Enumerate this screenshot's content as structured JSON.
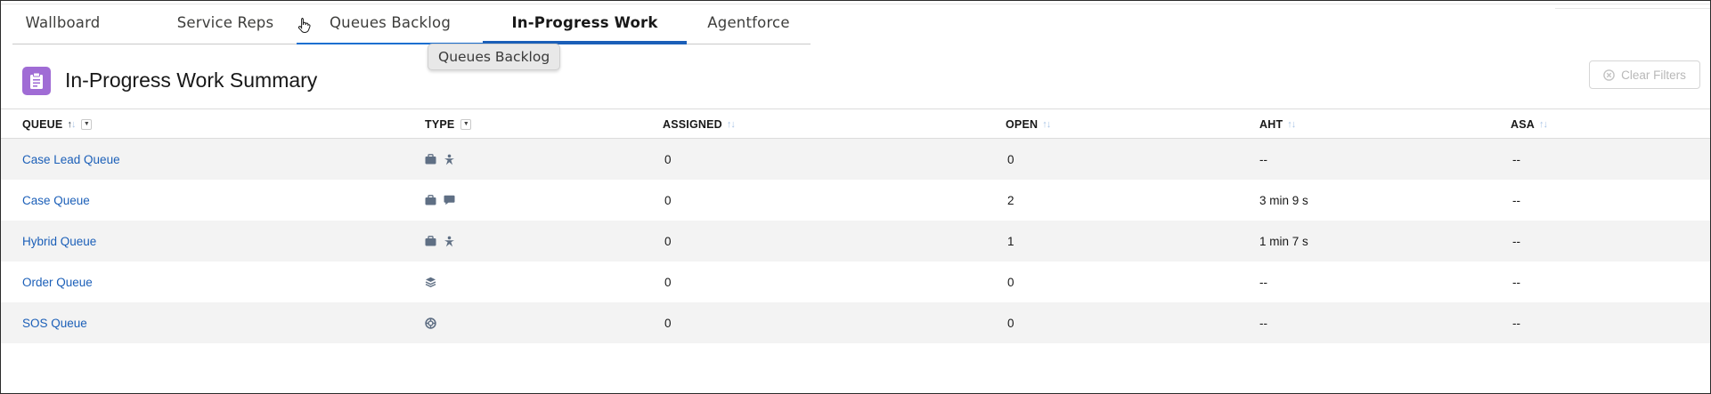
{
  "tabs": [
    {
      "label": "Wallboard",
      "state": "default"
    },
    {
      "label": "Service Reps",
      "state": "default"
    },
    {
      "label": "Queues Backlog",
      "state": "hovered"
    },
    {
      "label": "In-Progress Work",
      "state": "active"
    },
    {
      "label": "Agentforce",
      "state": "default"
    }
  ],
  "tooltip": "Queues Backlog",
  "header": {
    "title": "In-Progress Work Summary",
    "icon": "clipboard-icon",
    "clear_filters_label": "Clear Filters"
  },
  "table": {
    "columns": [
      {
        "label": "QUEUE",
        "sort": "ascending",
        "filter": true
      },
      {
        "label": "TYPE",
        "sort": "none",
        "filter": true
      },
      {
        "label": "ASSIGNED",
        "sort": "sortable"
      },
      {
        "label": "OPEN",
        "sort": "sortable"
      },
      {
        "label": "AHT",
        "sort": "sortable"
      },
      {
        "label": "ASA",
        "sort": "sortable"
      }
    ],
    "rows": [
      {
        "queue": "Case Lead Queue",
        "type_icons": [
          "briefcase-icon",
          "lead-icon"
        ],
        "assigned": "0",
        "open": "0",
        "aht": "--",
        "asa": "--"
      },
      {
        "queue": "Case Queue",
        "type_icons": [
          "briefcase-icon",
          "chat-icon"
        ],
        "assigned": "0",
        "open": "2",
        "aht": "3 min 9 s",
        "asa": "--"
      },
      {
        "queue": "Hybrid Queue",
        "type_icons": [
          "briefcase-icon",
          "lead-icon"
        ],
        "assigned": "0",
        "open": "1",
        "aht": "1 min 7 s",
        "asa": "--"
      },
      {
        "queue": "Order Queue",
        "type_icons": [
          "order-stack-icon"
        ],
        "assigned": "0",
        "open": "0",
        "aht": "--",
        "asa": "--"
      },
      {
        "queue": "SOS Queue",
        "type_icons": [
          "lifebuoy-icon"
        ],
        "assigned": "0",
        "open": "0",
        "aht": "--",
        "asa": "--"
      }
    ]
  },
  "colors": {
    "accent": "#1b5fb8",
    "header_icon_bg": "#a06cd5",
    "row_alt": "#f3f3f3",
    "type_icon": "#5f6f84"
  }
}
